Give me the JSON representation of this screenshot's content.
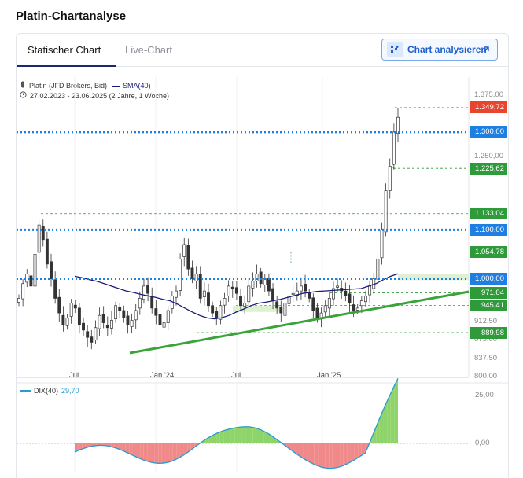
{
  "page": {
    "title": "Platin-Chartanalyse"
  },
  "tabs": [
    {
      "label": "Statischer Chart",
      "active": true
    },
    {
      "label": "Live-Chart",
      "active": false
    }
  ],
  "analyze_button": {
    "label": "Chart analysieren",
    "icon": "chart-grid-icon",
    "arrow_icon": "arrow-up-right-icon"
  },
  "legend": {
    "instrument": "Platin (JFD Brokers, Bid)",
    "sma": "SMA(40)",
    "range": "27.02.2023 - 23.06.2025  (2 Jahre, 1 Woche)",
    "clock_icon": "clock-icon"
  },
  "indicator_legend": {
    "name": "DIX(40)",
    "value": "29,70"
  },
  "colors": {
    "accent": "#1f5fcf",
    "level_blue": "#1e7fe0",
    "price_red": "#e8452f",
    "price_green": "#2e9a3a",
    "sma": "#1b1b7a",
    "trend": "#3aa33a",
    "dix_up": "#8fd46a",
    "dix_down": "#f08a8a",
    "dix_line": "#2a9ad0"
  },
  "chart_data": {
    "type": "candlestick",
    "y_ticks": [
      "1.375,00",
      "1.250,00",
      "912,50",
      "875,00",
      "837,50",
      "800,00"
    ],
    "x_ticks": [
      "Jul",
      "Jan '24",
      "Jul",
      "Jan '25"
    ],
    "ylim": [
      800,
      1400
    ],
    "indicator_ticks": [
      "25,00",
      "0,00"
    ],
    "price_labels": [
      {
        "value": 1349.72,
        "text": "1.349,72",
        "kind": "red"
      },
      {
        "value": 1300.0,
        "text": "1.300,00",
        "kind": "blue"
      },
      {
        "value": 1225.62,
        "text": "1.225,62",
        "kind": "green"
      },
      {
        "value": 1133.04,
        "text": "1.133,04",
        "kind": "green"
      },
      {
        "value": 1100.0,
        "text": "1.100,00",
        "kind": "blue"
      },
      {
        "value": 1054.78,
        "text": "1.054,78",
        "kind": "green"
      },
      {
        "value": 1000.0,
        "text": "1.000,00",
        "kind": "blue"
      },
      {
        "value": 971.04,
        "text": "971,04",
        "kind": "green"
      },
      {
        "value": 945.41,
        "text": "945,41",
        "kind": "green"
      },
      {
        "value": 889.98,
        "text": "889,98",
        "kind": "green"
      }
    ],
    "blue_levels": [
      1300,
      1100,
      1000
    ],
    "series": [
      {
        "name": "Platin (JFD Brokers, Bid)",
        "kind": "ohlc_close",
        "values": [
          960,
          990,
          1010,
          985,
          1050,
          1110,
          1080,
          1030,
          1000,
          960,
          930,
          905,
          920,
          950,
          940,
          905,
          895,
          880,
          870,
          900,
          925,
          910,
          900,
          915,
          945,
          935,
          920,
          905,
          915,
          935,
          960,
          985,
          970,
          940,
          925,
          905,
          910,
          935,
          965,
          975,
          1040,
          1070,
          1020,
          1000,
          1010,
          960,
          975,
          945,
          930,
          920,
          945,
          960,
          985,
          980,
          970,
          945,
          950,
          985,
          995,
          1010,
          990,
          1000,
          975,
          955,
          940,
          930,
          950,
          965,
          970,
          975,
          985,
          975,
          960,
          935,
          920,
          930,
          945,
          960,
          980,
          985,
          975,
          965,
          950,
          935,
          940,
          955,
          965,
          985,
          1000,
          1040,
          1100,
          1180,
          1230,
          1300,
          1330
        ]
      },
      {
        "name": "SMA(40)",
        "kind": "line",
        "values": [
          1005,
          1002,
          998,
          995,
          990,
          985,
          980,
          975,
          972,
          968,
          965,
          962,
          958,
          955,
          948,
          940,
          932,
          925,
          920,
          918,
          920,
          925,
          932,
          938,
          945,
          950,
          952,
          955,
          958,
          962,
          966,
          970,
          972,
          974,
          975,
          976,
          977,
          978,
          979,
          980,
          985,
          990,
          998,
          1005,
          1010
        ]
      }
    ]
  }
}
